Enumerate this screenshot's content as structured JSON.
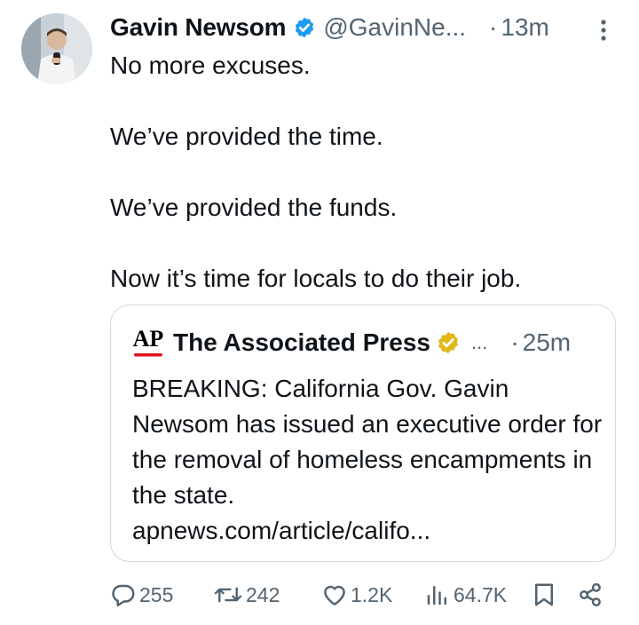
{
  "tweet": {
    "author_name": "Gavin Newsom",
    "handle": "@GavinNe...",
    "dot": "·",
    "time": "13m",
    "verified_icon": "blue-verified-badge",
    "text": [
      "No more excuses.",
      "We’ve provided the time.",
      "We’ve provided the funds.",
      "Now it’s time for locals to do their job."
    ]
  },
  "quote": {
    "logo_text": "AP",
    "author_name": "The Associated Press",
    "ellipsis": "...",
    "dot": "·",
    "time": "25m",
    "badge_icon": "gold-verified-badge",
    "text": "BREAKING: California Gov. Gavin Newsom has issued an executive order for the removal of homeless encampments in the state.",
    "link": "apnews.com/article/califo..."
  },
  "actions": {
    "replies": "255",
    "reposts": "242",
    "likes": "1.2K",
    "views": "64.7K"
  },
  "colors": {
    "text": "#0f1419",
    "muted": "#536471",
    "border": "#cfd9de",
    "verified_blue": "#1d9bf0",
    "verified_gold": "#e2b719",
    "ap_red": "#e0161f"
  }
}
